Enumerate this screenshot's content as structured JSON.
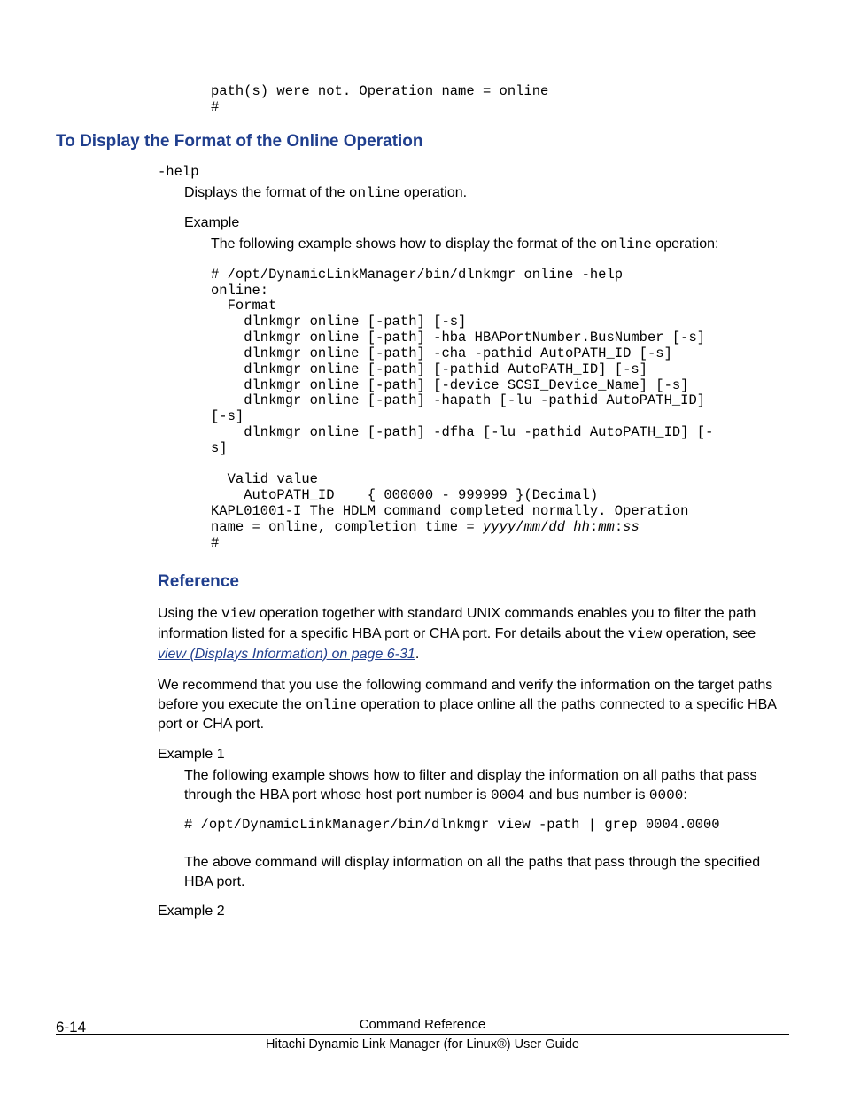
{
  "top_code": "path(s) were not. Operation name = online\n#",
  "section": {
    "heading": "To Display the Format of the Online Operation",
    "term": "-help",
    "desc_pre": "Displays the format of the ",
    "desc_code": "online",
    "desc_post": " operation.",
    "example_label": "Example",
    "example_pre": "The following example shows how to display the format of the ",
    "example_code": "online",
    "example_post": " operation:",
    "code_a": "# /opt/DynamicLinkManager/bin/dlnkmgr online -help\nonline:\n  Format\n    dlnkmgr online [-path] [-s]\n    dlnkmgr online [-path] -hba HBAPortNumber.BusNumber [-s]\n    dlnkmgr online [-path] -cha -pathid AutoPATH_ID [-s]\n    dlnkmgr online [-path] [-pathid AutoPATH_ID] [-s]\n    dlnkmgr online [-path] [-device SCSI_Device_Name] [-s]\n    dlnkmgr online [-path] -hapath [-lu -pathid AutoPATH_ID] \n[-s]\n    dlnkmgr online [-path] -dfha [-lu -pathid AutoPATH_ID] [-\ns]\n\n  Valid value\n    AutoPATH_ID    { 000000 - 999999 }(Decimal)",
    "code_b_pre": "KAPL01001-I The HDLM command completed normally. Operation \nname = online, completion time = ",
    "code_b_it": "yyyy",
    "code_b_s1": "/",
    "code_b_it2": "mm",
    "code_b_s2": "/",
    "code_b_it3": "dd hh",
    "code_b_s3": ":",
    "code_b_it4": "mm",
    "code_b_s4": ":",
    "code_b_it5": "ss",
    "code_b_post": "\n#"
  },
  "reference": {
    "heading": "Reference",
    "p1_a": "Using the ",
    "p1_code1": "view",
    "p1_b": " operation together with standard UNIX commands enables you to filter the path information listed for a specific HBA port or CHA port. For details about the ",
    "p1_code2": "view",
    "p1_c": " operation, see ",
    "p1_link": "view (Displays Information) on page 6-31",
    "p1_d": ".",
    "p2_a": "We recommend that you use the following command and verify the information on the target paths before you execute the ",
    "p2_code": "online",
    "p2_b": " operation to place online all the paths connected to a specific HBA port or CHA port.",
    "ex1_label": "Example 1",
    "ex1_a": "The following example shows how to filter and display the information on all paths that pass through the HBA port whose host port number is ",
    "ex1_code1": "0004",
    "ex1_b": " and bus number is ",
    "ex1_code2": "0000",
    "ex1_c": ":",
    "ex1_cmd": "# /opt/DynamicLinkManager/bin/dlnkmgr view -path | grep 0004.0000",
    "ex1_after": "The above command will display information on all the paths that pass through the specified HBA port.",
    "ex2_label": "Example 2"
  },
  "footer": {
    "pagenum": "6-14",
    "title": "Command Reference",
    "subtitle": "Hitachi Dynamic Link Manager (for Linux®) User Guide"
  }
}
